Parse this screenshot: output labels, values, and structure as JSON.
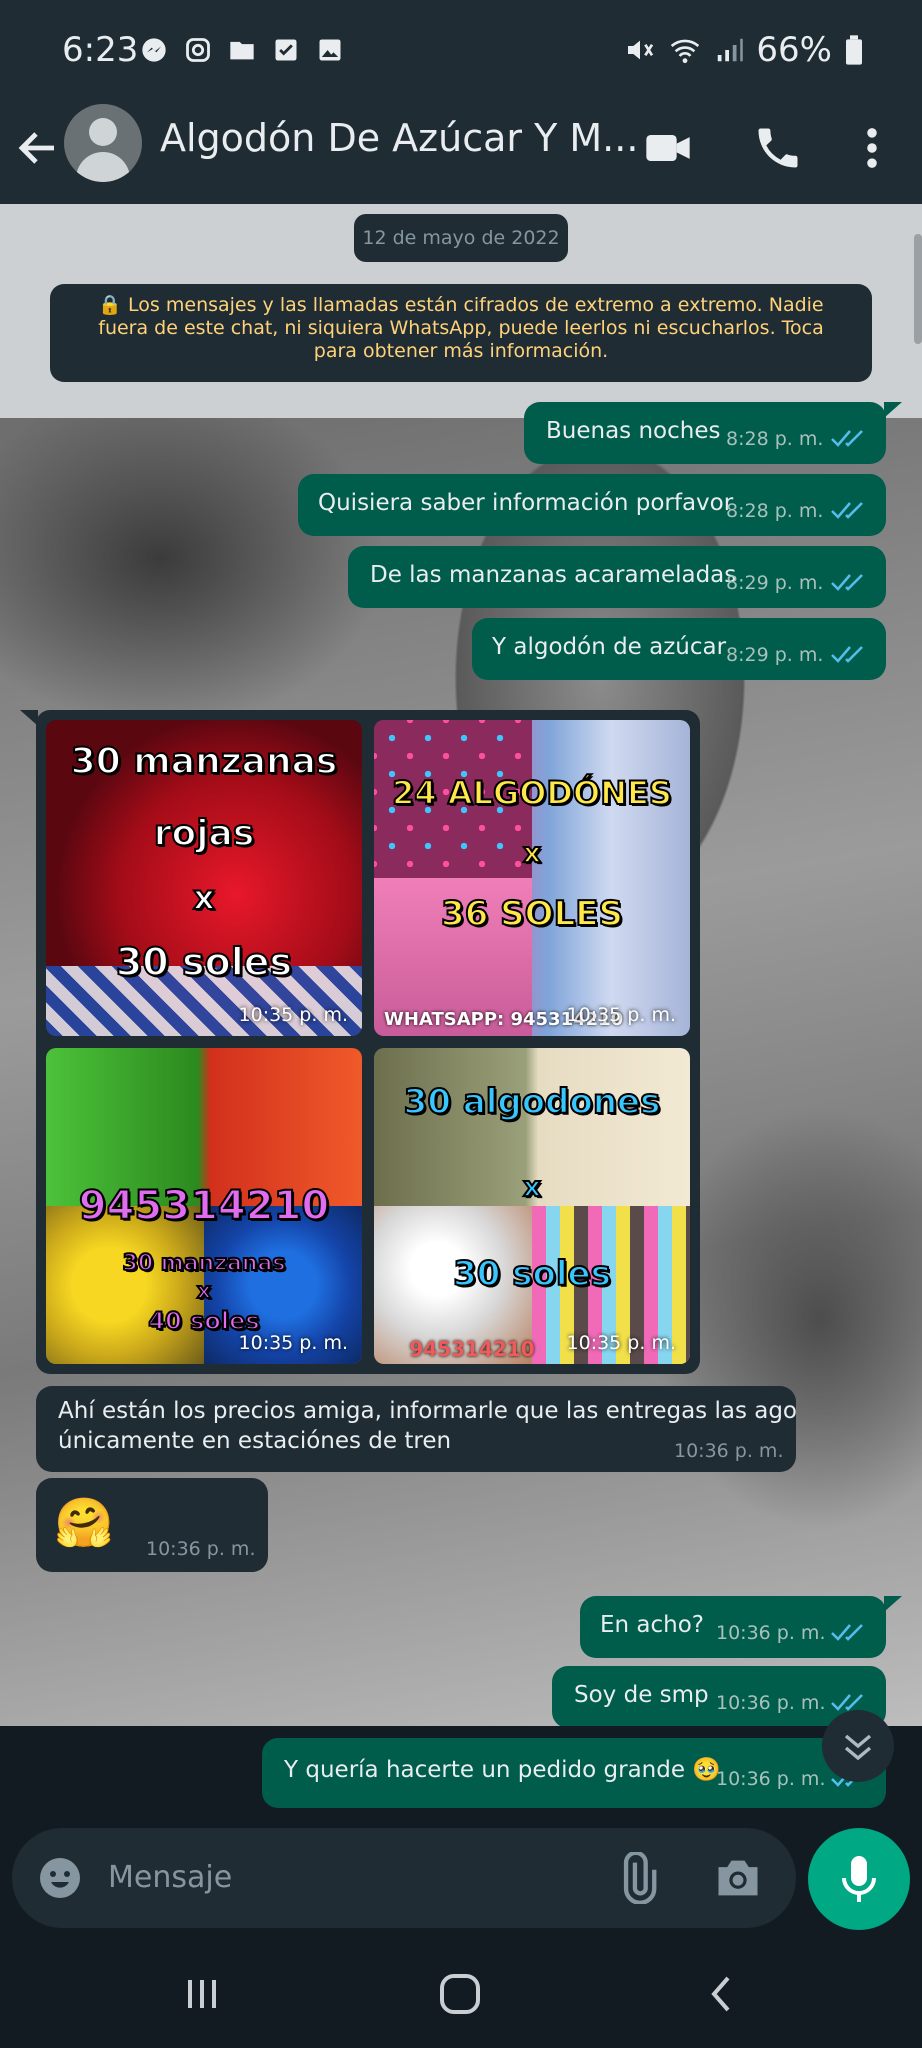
{
  "status_bar": {
    "time": "6:23",
    "battery": "66%"
  },
  "header": {
    "contact_name": "Algodón De Azúcar Y M..."
  },
  "chat": {
    "date": "12 de mayo de 2022",
    "encryption_note": "🔒 Los mensajes y las llamadas están cifrados de extremo a extremo. Nadie fuera de este chat, ni siquiera WhatsApp, puede leerlos ni escucharlos. Toca para obtener más información.",
    "messages": [
      {
        "text": "Buenas noches",
        "time": "8:28 p. m."
      },
      {
        "text": "Quisiera saber información porfavor",
        "time": "8:28 p. m."
      },
      {
        "text": "De las manzanas acarameladas",
        "time": "8:29 p. m."
      },
      {
        "text": "Y algodón de azúcar",
        "time": "8:29 p. m."
      },
      {
        "text": "Ahí están los precios amiga, informarle que las entregas las ago",
        "text2": "únicamente en estaciónes de tren",
        "time": "10:36 p. m."
      },
      {
        "text": "🤗",
        "time": "10:36 p. m."
      },
      {
        "text": "En acho?",
        "time": "10:36 p. m."
      },
      {
        "text": "Soy de smp",
        "time": "10:36 p. m."
      },
      {
        "text": "Y quería hacerte un pedido grande 🥹",
        "time": "10:36 p. m."
      }
    ],
    "images": [
      {
        "lines": [
          "30 manzanas",
          "rojas",
          "x",
          "30 soles"
        ],
        "time": "10:35 p. m."
      },
      {
        "lines": [
          "24 ALGODÓNES",
          "x",
          "36 SOLES"
        ],
        "watermark": "WHATSAPP: 945314210",
        "time": "10:35 p. m."
      },
      {
        "lines": [
          "945314210",
          "30 manzanas",
          "x",
          "40 soles"
        ],
        "time": "10:35 p. m."
      },
      {
        "lines": [
          "30 algodones",
          "x",
          "30 soles"
        ],
        "watermark": "945314210",
        "time": "10:35 p. m."
      }
    ]
  },
  "input": {
    "placeholder": "Mensaje"
  },
  "colors": {
    "outgoing": "#005c4b",
    "incoming": "#1f2c34",
    "accent": "#00a884",
    "header": "#1f2c34"
  }
}
